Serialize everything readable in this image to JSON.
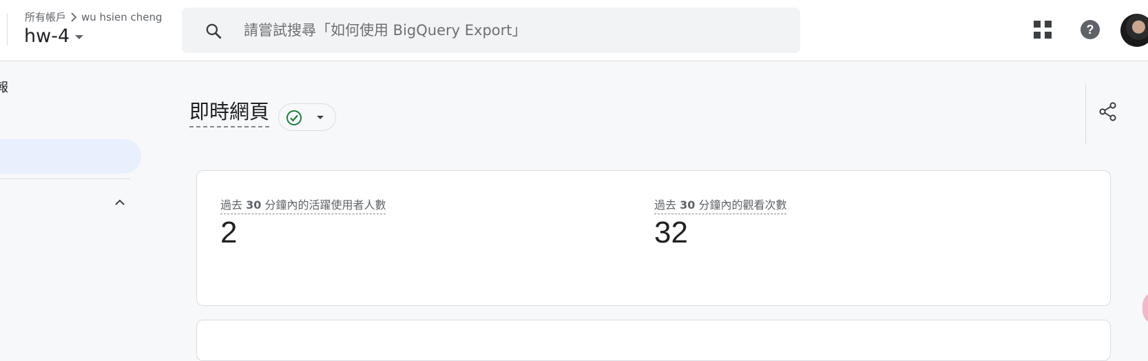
{
  "header": {
    "breadcrumb": {
      "root": "所有帳戶",
      "account": "wu hsien cheng"
    },
    "property_name": "hw-4",
    "search": {
      "placeholder": "請嘗試搜尋「如何使用 BigQuery Export」",
      "value": ""
    },
    "icons": [
      "search-icon",
      "apps-grid-icon",
      "help-icon",
      "avatar"
    ]
  },
  "sidebar": {
    "truncated_label": "報",
    "chevron": "chevron-up-icon"
  },
  "main": {
    "title": "即時網頁",
    "status_icon": "check-circle-icon",
    "share_icon": "share-icon",
    "metrics": [
      {
        "label_prefix": "過去 ",
        "label_bold": "30",
        "label_suffix": " 分鐘內的活躍使用者人數",
        "value": "2"
      },
      {
        "label_prefix": "過去 ",
        "label_bold": "30",
        "label_suffix": " 分鐘內的觀看次數",
        "value": "32"
      }
    ]
  },
  "colors": {
    "accent_active": "#e8effd",
    "status_green": "#188038",
    "background": "#f7f8fa"
  }
}
